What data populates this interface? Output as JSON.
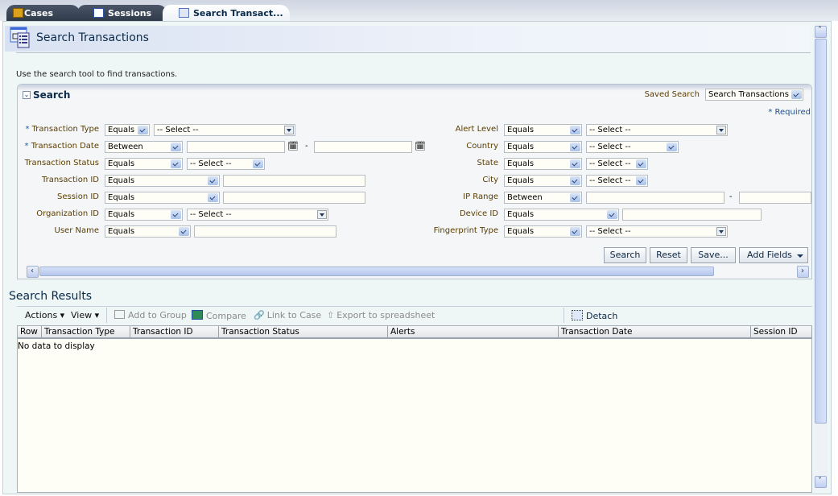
{
  "tabs": [
    {
      "label": "Cases",
      "icon": "briefcase-icon",
      "active": false
    },
    {
      "label": "Sessions",
      "icon": "session-icon",
      "active": false
    },
    {
      "label": "Search Transact...",
      "icon": "search-transactions-icon",
      "active": true
    }
  ],
  "page": {
    "title": "Search Transactions",
    "hint": "Use the search tool to find transactions."
  },
  "search": {
    "title": "Search",
    "saved_search_label": "Saved Search",
    "saved_search_value": "Search Transactions",
    "required_note": "* Required",
    "left_fields": [
      {
        "label": "Transaction Type",
        "required": true,
        "operator": "Equals",
        "value": "-- Select --"
      },
      {
        "label": "Transaction Date",
        "required": true,
        "operator": "Between",
        "value": "",
        "value2": ""
      },
      {
        "label": "Transaction Status",
        "required": false,
        "operator": "Equals",
        "value": "-- Select --"
      },
      {
        "label": "Transaction ID",
        "required": false,
        "operator": "Equals",
        "value": ""
      },
      {
        "label": "Session ID",
        "required": false,
        "operator": "Equals",
        "value": ""
      },
      {
        "label": "Organization ID",
        "required": false,
        "operator": "Equals",
        "value": "-- Select --"
      },
      {
        "label": "User Name",
        "required": false,
        "operator": "Equals",
        "value": ""
      }
    ],
    "right_fields": [
      {
        "label": "Alert Level",
        "operator": "Equals",
        "value": "-- Select --"
      },
      {
        "label": "Country",
        "operator": "Equals",
        "value": "-- Select --"
      },
      {
        "label": "State",
        "operator": "Equals",
        "value": "-- Select --"
      },
      {
        "label": "City",
        "operator": "Equals",
        "value": "-- Select --"
      },
      {
        "label": "IP Range",
        "operator": "Between",
        "value": "",
        "value2": ""
      },
      {
        "label": "Device ID",
        "operator": "Equals",
        "value": ""
      },
      {
        "label": "Fingerprint Type",
        "operator": "Equals",
        "value": "-- Select --"
      }
    ],
    "range_separator": "-",
    "buttons": {
      "search": "Search",
      "reset": "Reset",
      "save": "Save...",
      "add_fields": "Add Fields"
    }
  },
  "results": {
    "title": "Search Results",
    "toolbar": {
      "actions": "Actions",
      "view": "View",
      "add_to_group": "Add to Group",
      "compare": "Compare",
      "link_to_case": "Link to Case",
      "export": "Export to spreadsheet",
      "detach": "Detach"
    },
    "columns": [
      "Row",
      "Transaction Type",
      "Transaction ID",
      "Transaction Status",
      "Alerts",
      "Transaction Date",
      "Session ID"
    ],
    "empty_message": "No data to display"
  }
}
